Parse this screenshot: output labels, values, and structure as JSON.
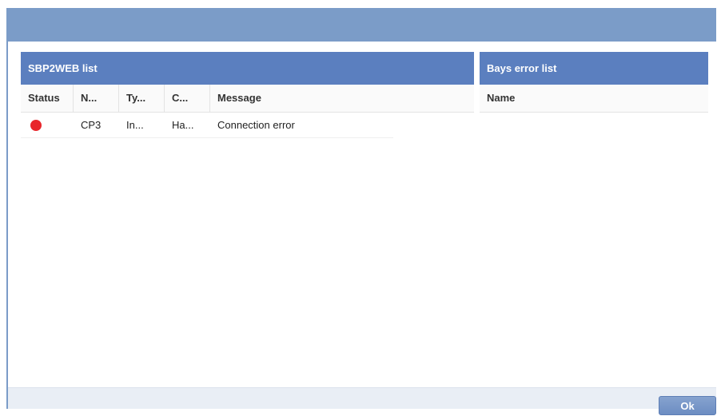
{
  "dialog": {
    "ok_label": "Ok"
  },
  "sbp2web": {
    "title": "SBP2WEB list",
    "columns": [
      "Status",
      "N...",
      "Ty...",
      "C...",
      "Message"
    ],
    "rows": [
      {
        "status_color": "#e8262b",
        "name": "CP3",
        "type": "In...",
        "c": "Ha...",
        "message": "Connection error"
      }
    ]
  },
  "bays": {
    "title": "Bays error list",
    "columns": [
      "Name"
    ]
  },
  "colors": {
    "header": "#7b9cc8",
    "panel_title": "#5b7fbf",
    "error": "#e8262b"
  }
}
